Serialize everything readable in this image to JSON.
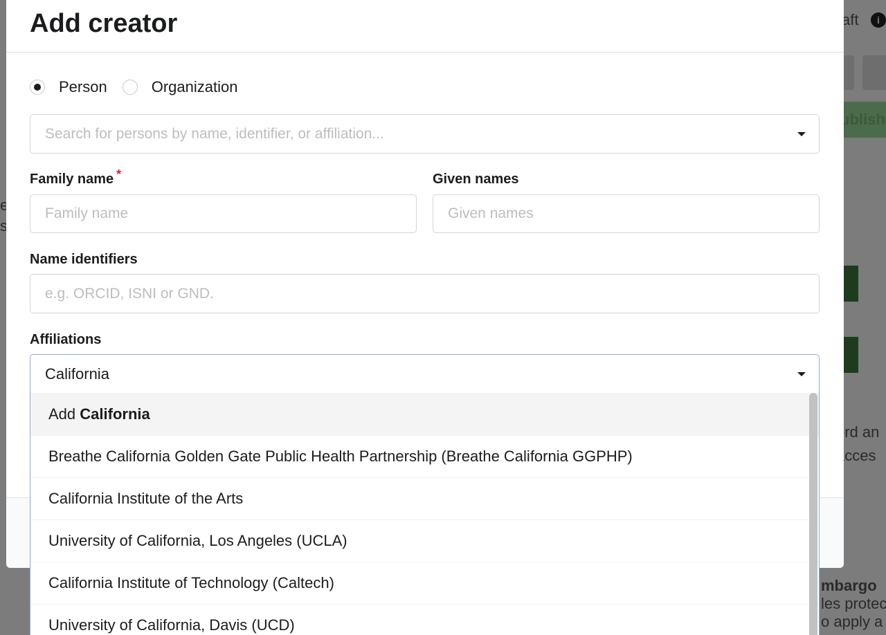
{
  "background": {
    "top_right_text": "aft",
    "publish_text": "ublish",
    "right_text_1": "ord an",
    "right_text_2": "acces",
    "embargo_title": "mbargo",
    "embargo_line_1": "les protec",
    "embargo_line_2": "o apply a",
    "left_fragment_1": "e",
    "left_fragment_2": "s"
  },
  "modal": {
    "title": "Add creator",
    "type_options": [
      {
        "label": "Person",
        "selected": true
      },
      {
        "label": "Organization",
        "selected": false
      }
    ],
    "search": {
      "placeholder": "Search for persons by name, identifier, or affiliation..."
    },
    "family_name": {
      "label": "Family name",
      "required_mark": "*",
      "placeholder": "Family name",
      "value": ""
    },
    "given_names": {
      "label": "Given names",
      "placeholder": "Given names",
      "value": ""
    },
    "name_identifiers": {
      "label": "Name identifiers",
      "placeholder": "e.g. ORCID, ISNI or GND."
    },
    "affiliations": {
      "label": "Affiliations",
      "value": "California",
      "add_option": {
        "prefix": "Add",
        "term": "California"
      },
      "options": [
        "Breathe California Golden Gate Public Health Partnership (Breathe California GGPHP)",
        "California Institute of the Arts",
        "University of California, Los Angeles (UCLA)",
        "California Institute of Technology (Caltech)",
        "University of California, Davis (UCD)"
      ]
    }
  },
  "colors": {
    "accent_border": "#7fb1d8",
    "required": "#db2828",
    "menu_hover": "#f4f4f4"
  }
}
